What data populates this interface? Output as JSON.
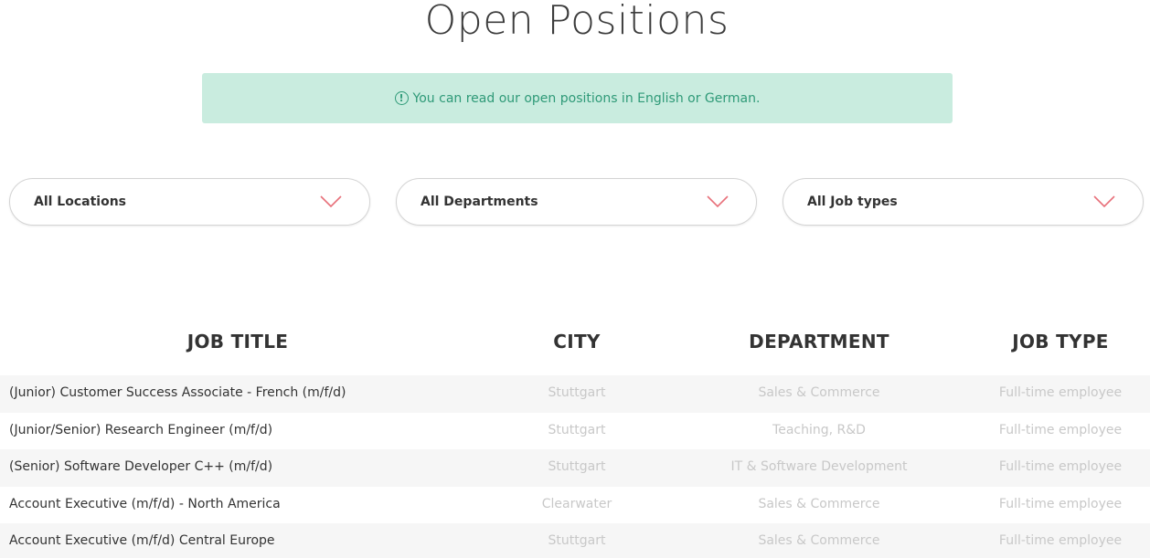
{
  "page": {
    "title": "Open Positions"
  },
  "notice": {
    "icon": "info-circle-icon",
    "text": "You can read our open positions in English or German."
  },
  "filters": [
    {
      "label": "All Locations",
      "icon": "chevron-down-icon"
    },
    {
      "label": "All Departments",
      "icon": "chevron-down-icon"
    },
    {
      "label": "All Job types",
      "icon": "chevron-down-icon"
    }
  ],
  "table": {
    "headers": {
      "title": "JOB TITLE",
      "city": "CITY",
      "department": "DEPARTMENT",
      "job_type": "JOB TYPE"
    },
    "rows": [
      {
        "title": "(Junior) Customer Success Associate - French (m/f/d)",
        "city": "Stuttgart",
        "department": "Sales & Commerce",
        "job_type": "Full-time employee"
      },
      {
        "title": "(Junior/Senior) Research Engineer (m/f/d)",
        "city": "Stuttgart",
        "department": "Teaching, R&D",
        "job_type": "Full-time employee"
      },
      {
        "title": "(Senior) Software Developer C++ (m/f/d)",
        "city": "Stuttgart",
        "department": "IT & Software Development",
        "job_type": "Full-time employee"
      },
      {
        "title": "Account Executive (m/f/d) - North America",
        "city": "Clearwater",
        "department": "Sales & Commerce",
        "job_type": "Full-time employee"
      },
      {
        "title": "Account Executive (m/f/d) Central Europe",
        "city": "Stuttgart",
        "department": "Sales & Commerce",
        "job_type": "Full-time employee"
      }
    ]
  },
  "colors": {
    "notice_bg": "#c9ecdf",
    "notice_text": "#2f9a78",
    "chevron": "#e8707a",
    "row_alt": "#f6f6f6",
    "muted_text": "#c8c8c8"
  }
}
